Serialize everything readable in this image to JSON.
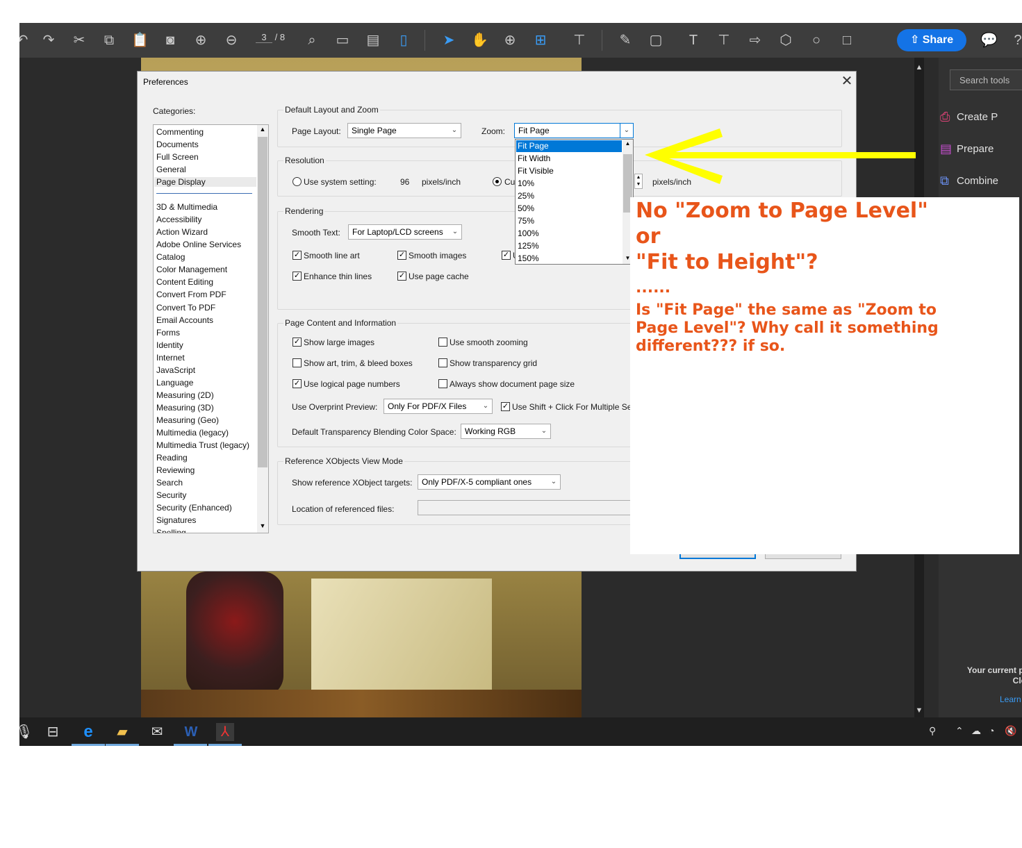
{
  "toolbar": {
    "page_current": "3",
    "page_total": "/ 8",
    "share_label": "Share",
    "icons": [
      "undo-icon",
      "redo-icon",
      "cut-icon",
      "copy-icon",
      "paste-icon",
      "snapshot-icon",
      "prev-page-icon",
      "next-page-icon",
      "marquee-zoom-icon",
      "fit-width-icon",
      "image-icon",
      "page-icon",
      "select-icon",
      "hand-icon",
      "zoom-in-icon",
      "zoom-menu-icon",
      "stamp-icon",
      "highlight-icon",
      "add-file-icon",
      "text-icon",
      "textbox-icon",
      "arrow-shape-icon",
      "polygon-icon",
      "circle-icon",
      "rectangle-icon",
      "comment-icon",
      "help-icon"
    ]
  },
  "right_panel": {
    "search_placeholder": "Search tools",
    "tools": [
      {
        "label": "Create P",
        "icon": "create-pdf-icon"
      },
      {
        "label": "Prepare",
        "icon": "prepare-form-icon"
      },
      {
        "label": "Combine",
        "icon": "combine-files-icon"
      }
    ],
    "plan_line1": "Your current pl",
    "plan_line2": "Clo",
    "learn_label": "Learn"
  },
  "dialog": {
    "title": "Preferences",
    "categories_label": "Categories:",
    "categories_top": [
      "Commenting",
      "Documents",
      "Full Screen",
      "General",
      "Page Display"
    ],
    "categories_rest": [
      "3D & Multimedia",
      "Accessibility",
      "Action Wizard",
      "Adobe Online Services",
      "Catalog",
      "Color Management",
      "Content Editing",
      "Convert From PDF",
      "Convert To PDF",
      "Email Accounts",
      "Forms",
      "Identity",
      "Internet",
      "JavaScript",
      "Language",
      "Measuring (2D)",
      "Measuring (3D)",
      "Measuring (Geo)",
      "Multimedia (legacy)",
      "Multimedia Trust (legacy)",
      "Reading",
      "Reviewing",
      "Search",
      "Security",
      "Security (Enhanced)",
      "Signatures",
      "Spelling"
    ],
    "selected_category": "Page Display",
    "layout_group": {
      "title": "Default Layout and Zoom",
      "page_layout_label": "Page Layout:",
      "page_layout_value": "Single Page",
      "zoom_label": "Zoom:",
      "zoom_value": "Fit Page",
      "zoom_options": [
        "Fit Page",
        "Fit Width",
        "Fit Visible",
        "10%",
        "25%",
        "50%",
        "75%",
        "100%",
        "125%",
        "150%"
      ]
    },
    "resolution_group": {
      "title": "Resolution",
      "system_label": "Use system setting:",
      "system_value": "96",
      "system_unit": "pixels/inch",
      "custom_label": "Cu",
      "custom_unit": "pixels/inch"
    },
    "rendering_group": {
      "title": "Rendering",
      "smooth_text_label": "Smooth Text:",
      "smooth_text_value": "For Laptop/LCD screens",
      "smooth_line_art": "Smooth line art",
      "smooth_images": "Smooth images",
      "third_check": "U",
      "enhance_thin_lines": "Enhance thin lines",
      "use_page_cache": "Use page cache"
    },
    "content_group": {
      "title": "Page Content and Information",
      "show_large_images": "Show large images",
      "use_smooth_zooming": "Use smooth zooming",
      "show_art_trim": "Show art, trim, & bleed boxes",
      "show_transparency_grid": "Show transparency grid",
      "use_logical_page_numbers": "Use logical page numbers",
      "always_show_page_size": "Always show document page size",
      "overprint_label": "Use Overprint Preview:",
      "overprint_value": "Only For PDF/X Files",
      "shift_click": "Use Shift + Click For Multiple Sel",
      "blend_label": "Default Transparency Blending Color Space:",
      "blend_value": "Working RGB"
    },
    "xobjects_group": {
      "title": "Reference XObjects View Mode",
      "targets_label": "Show reference XObject targets:",
      "targets_value": "Only PDF/X-5 compliant ones",
      "location_label": "Location of referenced files:",
      "location_value": ""
    }
  },
  "annotation": {
    "line1": "No \"Zoom to Page Level\"",
    "line2": "or",
    "line3": "\"Fit to Height\"?",
    "dots": "......",
    "line4": "Is \"Fit Page\" the same as \"Zoom to",
    "line5": "Page Level\"?   Why call it something",
    "line6": "different??? if so.",
    "arrow_color": "#ffff00",
    "text_color": "#e8551a"
  },
  "taskbar": {
    "icons": [
      "cortana-mic-icon",
      "task-view-icon",
      "edge-icon",
      "file-explorer-icon",
      "mail-icon",
      "word-icon",
      "acrobat-icon"
    ],
    "tray_icons": [
      "people-icon",
      "chevron-up-icon",
      "onedrive-icon",
      "wifi-icon",
      "volume-muted-icon"
    ]
  }
}
